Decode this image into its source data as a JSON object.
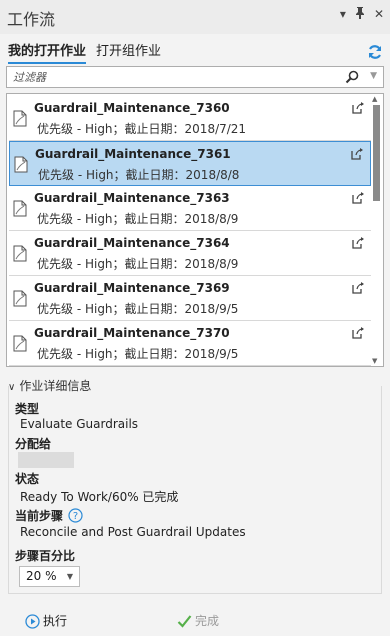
{
  "window": {
    "title": "工作流"
  },
  "tabs": [
    {
      "label": "我的打开作业"
    },
    {
      "label": "打开组作业"
    }
  ],
  "filter": {
    "placeholder": "过滤器"
  },
  "jobs": [
    {
      "name": "Guardrail_Maintenance_7360",
      "meta": "优先级 - High；截止日期：2018/7/21"
    },
    {
      "name": "Guardrail_Maintenance_7361",
      "meta": "优先级 - High；截止日期：2018/8/8",
      "selected": true
    },
    {
      "name": "Guardrail_Maintenance_7363",
      "meta": "优先级 - High；截止日期：2018/8/9"
    },
    {
      "name": "Guardrail_Maintenance_7364",
      "meta": "优先级 - High；截止日期：2018/8/9"
    },
    {
      "name": "Guardrail_Maintenance_7369",
      "meta": "优先级 - High；截止日期：2018/9/5"
    },
    {
      "name": "Guardrail_Maintenance_7370",
      "meta": "优先级 - High；截止日期：2018/9/5"
    }
  ],
  "details": {
    "header": "作业详细信息",
    "type_label": "类型",
    "type_value": "Evaluate Guardrails",
    "assigned_label": "分配给",
    "status_label": "状态",
    "status_value": "Ready To Work/60% 已完成",
    "step_label": "当前步骤",
    "step_value": "Reconcile and Post Guardrail Updates",
    "percent_label": "步骤百分比",
    "percent_value": "20 %"
  },
  "footer": {
    "execute": "执行",
    "complete": "完成"
  },
  "colors": {
    "accent": "#2b8ad6",
    "selected_bg": "#b9d9f2",
    "complete_check": "#56b04a"
  }
}
